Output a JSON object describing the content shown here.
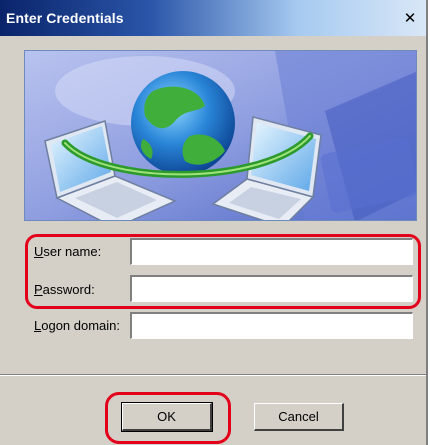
{
  "window": {
    "title": "Enter Credentials",
    "close_glyph": "✕"
  },
  "banner": {
    "icon": "network-globe-laptops"
  },
  "form": {
    "username_label": "User name:",
    "username_mnemonic": "U",
    "username_rest": "ser name:",
    "username_value": "",
    "password_label": "Password:",
    "password_mnemonic": "P",
    "password_rest": "assword:",
    "password_value": "",
    "domain_label": "Logon domain:",
    "domain_mnemonic": "L",
    "domain_rest": "ogon domain:",
    "domain_value": ""
  },
  "buttons": {
    "ok_label": "OK",
    "cancel_label": "Cancel"
  },
  "colors": {
    "highlight": "#e3001b",
    "titlebar": "#0a246a",
    "dialog_bg": "#d4d0c8"
  }
}
